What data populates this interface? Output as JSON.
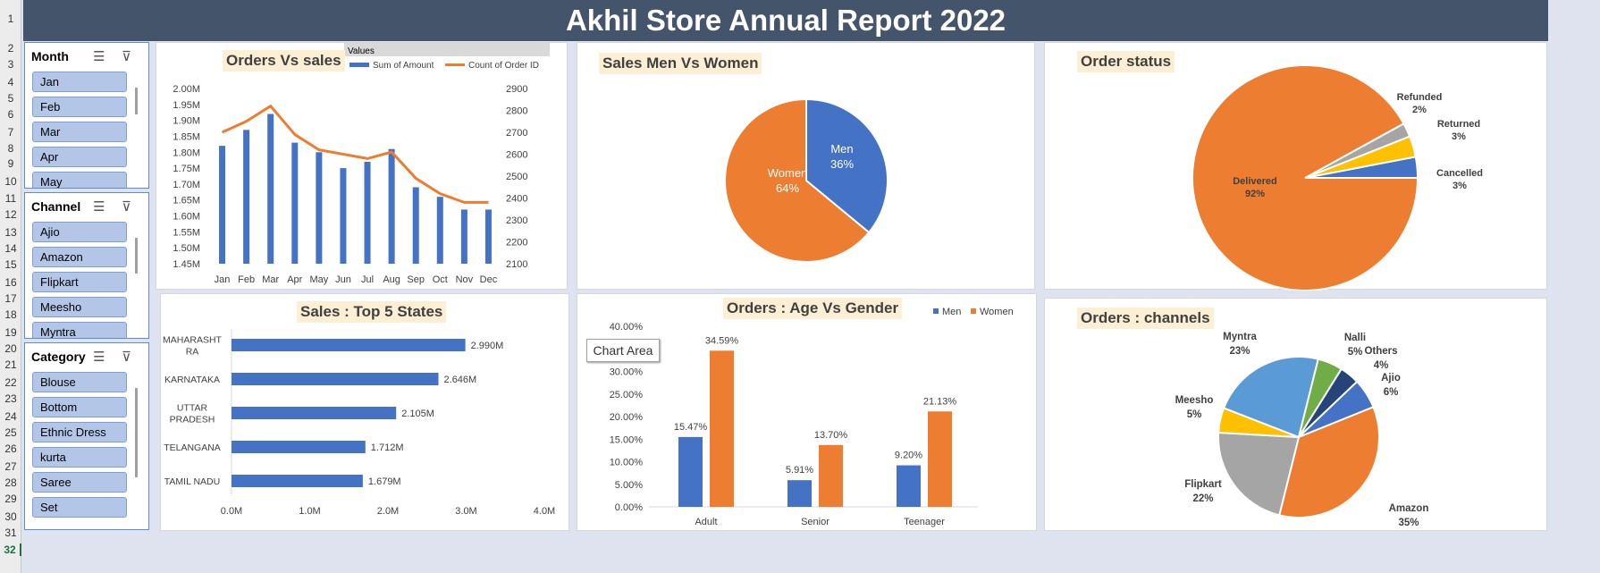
{
  "row_numbers": [
    "1",
    "2",
    "3",
    "4",
    "5",
    "6",
    "7",
    "8",
    "9",
    "10",
    "11",
    "12",
    "13",
    "14",
    "15",
    "16",
    "17",
    "18",
    "19",
    "20",
    "21",
    "22",
    "23",
    "24",
    "25",
    "26",
    "27",
    "28",
    "29",
    "30",
    "31",
    "32"
  ],
  "report_title": "Akhil Store Annual Report 2022",
  "slicers": [
    {
      "title": "Month",
      "items": [
        "Jan",
        "Feb",
        "Mar",
        "Apr",
        "May"
      ]
    },
    {
      "title": "Channel",
      "items": [
        "Ajio",
        "Amazon",
        "Flipkart",
        "Meesho",
        "Myntra"
      ]
    },
    {
      "title": "Category",
      "items": [
        "Blouse",
        "Bottom",
        "Ethnic Dress",
        "kurta",
        "Saree",
        "Set"
      ]
    }
  ],
  "tooltip": "Chart Area",
  "colors": {
    "blue": "#4472c4",
    "orange": "#ed7d31",
    "gray": "#a5a5a5",
    "yellow": "#ffc000",
    "lightblue": "#5b9bd5",
    "green": "#70ad47",
    "navy": "#264478"
  },
  "chart_data": [
    {
      "type": "bar+line",
      "title": "Orders Vs  sales",
      "legend_header": "Values",
      "categories": [
        "Jan",
        "Feb",
        "Mar",
        "Apr",
        "May",
        "Jun",
        "Jul",
        "Aug",
        "Sep",
        "Oct",
        "Nov",
        "Dec"
      ],
      "series": [
        {
          "name": "Sum of Amount",
          "type": "bar",
          "axis": "left",
          "values": [
            1.82,
            1.87,
            1.92,
            1.83,
            1.8,
            1.75,
            1.77,
            1.81,
            1.69,
            1.66,
            1.62,
            1.62
          ]
        },
        {
          "name": "Count of Order ID",
          "type": "line",
          "axis": "right",
          "values": [
            2700,
            2750,
            2820,
            2690,
            2620,
            2600,
            2580,
            2610,
            2490,
            2420,
            2380,
            2380
          ]
        }
      ],
      "yleft_ticks": [
        "2.00M",
        "1.95M",
        "1.90M",
        "1.85M",
        "1.80M",
        "1.75M",
        "1.70M",
        "1.65M",
        "1.60M",
        "1.55M",
        "1.50M",
        "1.45M"
      ],
      "yleft_range": [
        1.45,
        2.0
      ],
      "yright_ticks": [
        "2900",
        "2800",
        "2700",
        "2600",
        "2500",
        "2400",
        "2300",
        "2200",
        "2100"
      ],
      "yright_range": [
        2100,
        2900
      ]
    },
    {
      "type": "pie",
      "title": "Sales Men Vs Women",
      "slices": [
        {
          "label": "Men",
          "value": 36,
          "text": "36%"
        },
        {
          "label": "Women",
          "value": 64,
          "text": "64%"
        }
      ]
    },
    {
      "type": "pie",
      "title": "Order status",
      "slices": [
        {
          "label": "Delivered",
          "value": 92,
          "text": "92%"
        },
        {
          "label": "Refunded",
          "value": 2,
          "text": "2%"
        },
        {
          "label": "Returned",
          "value": 3,
          "text": "3%"
        },
        {
          "label": "Cancelled",
          "value": 3,
          "text": "3%"
        }
      ]
    },
    {
      "type": "bar",
      "orientation": "horizontal",
      "title": "Sales : Top 5 States",
      "categories": [
        [
          "MAHARASHT",
          "RA"
        ],
        [
          "KARNATAKA"
        ],
        [
          "UTTAR",
          "PRADESH"
        ],
        [
          "TELANGANA"
        ],
        [
          "TAMIL NADU"
        ]
      ],
      "values": [
        2.99,
        2.646,
        2.105,
        1.712,
        1.679
      ],
      "value_labels": [
        "2.990M",
        "2.646M",
        "2.105M",
        "1.712M",
        "1.679M"
      ],
      "xticks": [
        "0.0M",
        "1.0M",
        "2.0M",
        "3.0M",
        "4.0M"
      ],
      "xlim": [
        0,
        4
      ]
    },
    {
      "type": "bar",
      "title": "Orders : Age Vs Gender",
      "categories": [
        "Adult",
        "Senior",
        "Teenager"
      ],
      "series": [
        {
          "name": "Men",
          "values": [
            15.47,
            5.91,
            9.2
          ],
          "labels": [
            "15.47%",
            "5.91%",
            "9.20%"
          ]
        },
        {
          "name": "Women",
          "values": [
            34.59,
            13.7,
            21.13
          ],
          "labels": [
            "34.59%",
            "13.70%",
            "21.13%"
          ]
        }
      ],
      "yticks": [
        "40.00%",
        "35.00%",
        "30.00%",
        "25.00%",
        "20.00%",
        "15.00%",
        "10.00%",
        "5.00%",
        "0.00%"
      ],
      "ylim": [
        0,
        40
      ]
    },
    {
      "type": "pie",
      "title": "Orders : channels",
      "slices": [
        {
          "label": "Ajio",
          "value": 6,
          "text": "6%"
        },
        {
          "label": "Amazon",
          "value": 35,
          "text": "35%"
        },
        {
          "label": "Flipkart",
          "value": 22,
          "text": "22%"
        },
        {
          "label": "Meesho",
          "value": 5,
          "text": "5%"
        },
        {
          "label": "Myntra",
          "value": 23,
          "text": "23%"
        },
        {
          "label": "Nalli",
          "value": 5,
          "text": "5%"
        },
        {
          "label": "Others",
          "value": 4,
          "text": "4%"
        }
      ]
    }
  ]
}
